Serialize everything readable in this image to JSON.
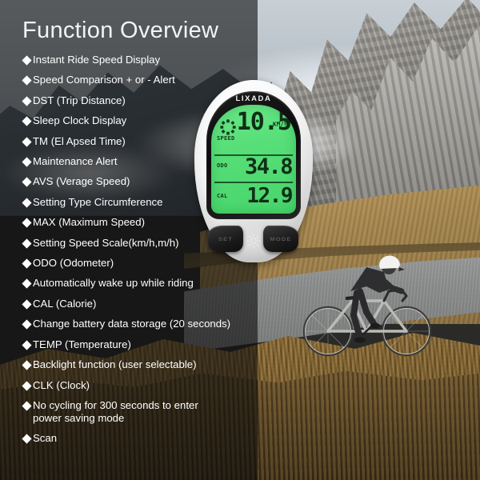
{
  "page": {
    "title": "Function Overview",
    "overlay_color": "#0c0c0c"
  },
  "features": [
    {
      "label": "Instant Ride Speed Display"
    },
    {
      "label": "Speed Comparison + or - Alert"
    },
    {
      "label": "DST (Trip Distance)"
    },
    {
      "label": "Sleep Clock Display"
    },
    {
      "label": "TM (El Apsed Time)"
    },
    {
      "label": "Maintenance Alert"
    },
    {
      "label": "AVS (Verage Speed)"
    },
    {
      "label": "Setting Type Circumference"
    },
    {
      "label": "MAX (Maximum Speed)"
    },
    {
      "label": "Setting Speed Scale(km/h,m/h)"
    },
    {
      "label": "ODO (Odometer)"
    },
    {
      "label": "Automatically wake up while riding"
    },
    {
      "label": "CAL (Calorie)"
    },
    {
      "label": "Change battery data storage (20 seconds)"
    },
    {
      "label": "TEMP (Temperature)"
    },
    {
      "label": "Backlight function (user selectable)"
    },
    {
      "label": "CLK (Clock)"
    },
    {
      "label": "No cycling for 300 seconds to enter power saving mode"
    },
    {
      "label": "Scan"
    }
  ],
  "device": {
    "brand": "LIXADA",
    "lcd_color": "#57de78",
    "display": {
      "speed_label": "SPEED",
      "speed_value": "10.5",
      "speed_unit": "KM/hr",
      "odo_label": "ODO",
      "odo_value": "34.8",
      "cal_label": "CAL",
      "cal_value": "12.9"
    },
    "buttons": {
      "set": "SET",
      "mode": "MODE"
    }
  }
}
